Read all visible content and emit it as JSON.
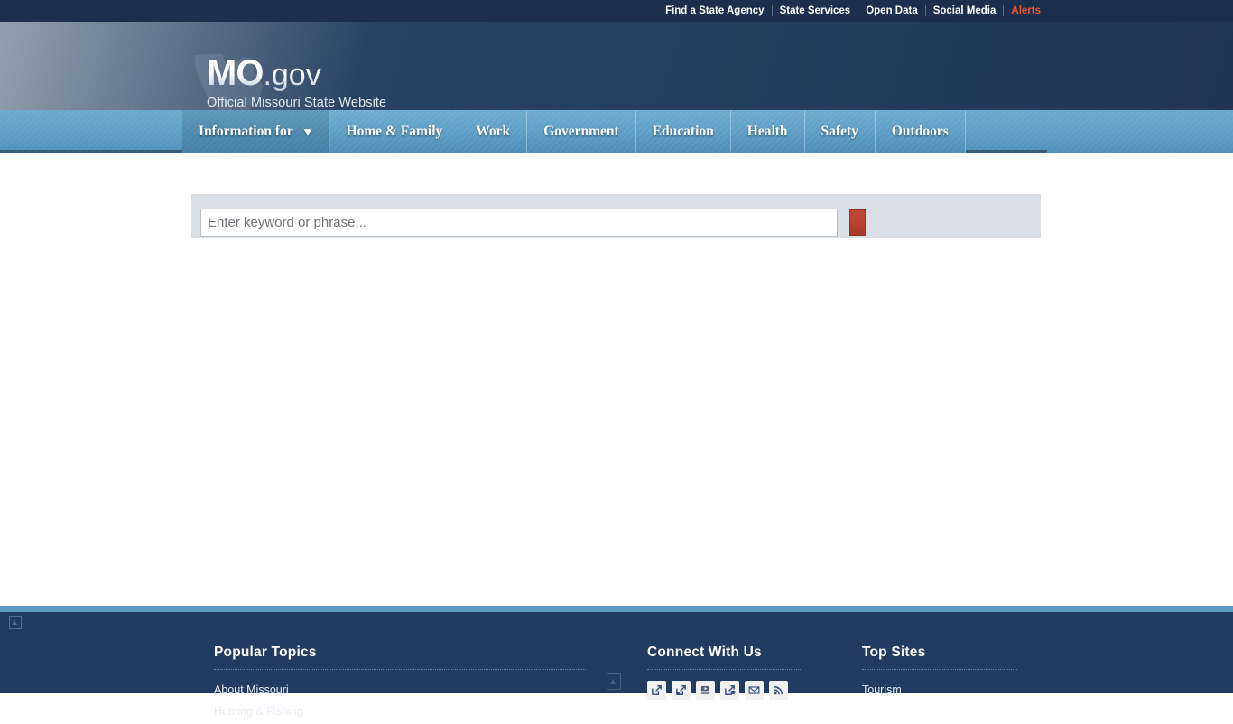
{
  "topbar": {
    "links": [
      {
        "label": "Find a State Agency",
        "accent": false
      },
      {
        "label": "State Services",
        "accent": false
      },
      {
        "label": "Open Data",
        "accent": false
      },
      {
        "label": "Social Media",
        "accent": false
      },
      {
        "label": "Alerts",
        "accent": true
      }
    ]
  },
  "header": {
    "logo_mo": "MO",
    "logo_gov": ".gov",
    "tagline": "Official Missouri State Website"
  },
  "nav": {
    "items": [
      {
        "label": "Information for",
        "active": true,
        "caret": "▼"
      },
      {
        "label": "Home & Family",
        "active": false
      },
      {
        "label": "Work",
        "active": false
      },
      {
        "label": "Government",
        "active": false
      },
      {
        "label": "Education",
        "active": false
      },
      {
        "label": "Health",
        "active": false
      },
      {
        "label": "Safety",
        "active": false
      },
      {
        "label": "Outdoors",
        "active": false
      }
    ]
  },
  "search": {
    "placeholder": "Enter keyword or phrase...",
    "value": "",
    "button_label": ""
  },
  "footer": {
    "popular": {
      "heading": "Popular Topics",
      "links": [
        "About Missouri",
        "Hunting & Fishing"
      ]
    },
    "connect": {
      "heading": "Connect With Us",
      "icons": [
        "external-link-icon",
        "external-link-icon",
        "youtube-icon",
        "external-link-icon",
        "email-icon",
        "rss-icon"
      ]
    },
    "top_sites": {
      "heading": "Top Sites",
      "links": [
        "Tourism"
      ]
    }
  },
  "colors": {
    "topbar_bg": "#1d2f4e",
    "header_bg": "#294365",
    "nav_bg": "#62a1c7",
    "nav_active": "#4e89ad",
    "accent_alert": "#e8552d",
    "search_panel": "#d9dfe5",
    "search_button": "#b8422f",
    "footer_bg": "#223c61",
    "footer_rule": "#5e9bc1"
  }
}
